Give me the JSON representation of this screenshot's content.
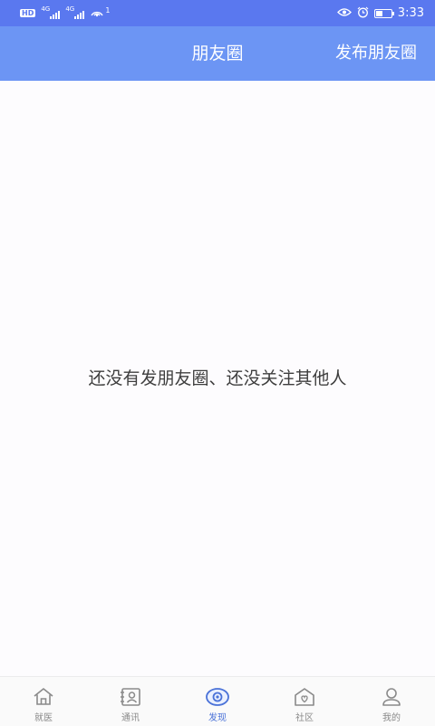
{
  "status_bar": {
    "left_badge": "HD",
    "network_1": "4G",
    "network_2": "4G",
    "hotspot_count": "1",
    "time": "3:33",
    "battery_level": 0.45,
    "icons": [
      "hd-icon",
      "signal-icon",
      "signal-icon",
      "hotspot-icon",
      "eye-icon",
      "alarm-icon",
      "battery-icon"
    ]
  },
  "header": {
    "title": "朋友圈",
    "action_label": "发布朋友圈"
  },
  "main": {
    "empty_message": "还没有发朋友圈、还没关注其他人"
  },
  "bottom_nav": {
    "items": [
      {
        "label": "就医",
        "icon": "home-icon"
      },
      {
        "label": "通讯",
        "icon": "contacts-icon"
      },
      {
        "label": "发现",
        "icon": "discover-icon",
        "active": true
      },
      {
        "label": "社区",
        "icon": "community-icon"
      },
      {
        "label": "我的",
        "icon": "profile-icon"
      }
    ]
  },
  "colors": {
    "status_bar_bg": "#5a78ef",
    "header_bg": "#6c95f4",
    "page_bg": "#fdfcfe",
    "nav_active": "#4a72d8",
    "nav_inactive": "#8a8a8a",
    "empty_text": "#3e3e3e"
  }
}
